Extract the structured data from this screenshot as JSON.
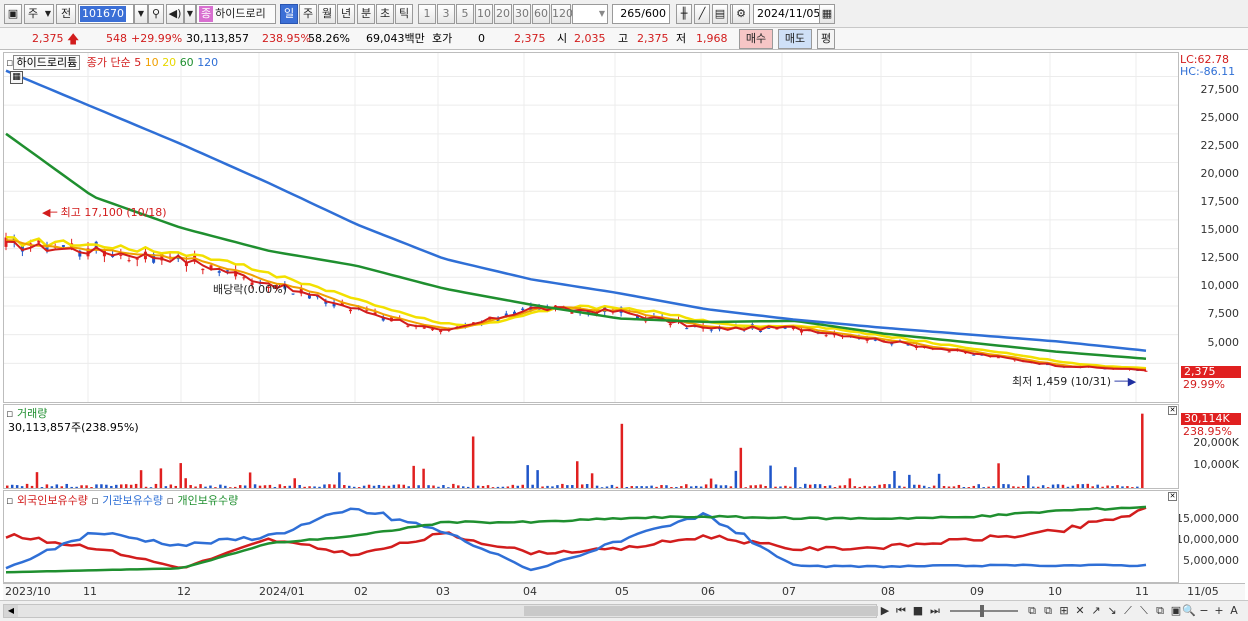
{
  "toolbar": {
    "period_select": "주",
    "prev_label": "전",
    "code": "101670",
    "stock_tag": "종",
    "stock_name": "하이드로리",
    "intervals": [
      "일",
      "주",
      "월",
      "년",
      "분",
      "초",
      "틱"
    ],
    "active_interval": "일",
    "counts": [
      "1",
      "3",
      "5",
      "10",
      "20",
      "30",
      "60",
      "120"
    ],
    "range_value": "265",
    "range_total": "/600",
    "date": "2024/11/05"
  },
  "quote": {
    "price": "2,375",
    "change": "548",
    "change_pct": "+29.99%",
    "volume": "30,113,857",
    "volume_pct": "238.95%",
    "turnover_pct": "58.26%",
    "amount": "69,043백만",
    "hoga_label": "호가",
    "hoga_value": "0",
    "hoga_price": "2,375",
    "open_label": "시",
    "open": "2,035",
    "high_label": "고",
    "high": "2,375",
    "low_label": "저",
    "low": "1,968",
    "buy_label": "매수",
    "sell_label": "매도",
    "avg_label": "평"
  },
  "price_panel": {
    "title": "하이드로리튬",
    "legend_main": "종가 단순",
    "ma_legend": [
      {
        "label": "5",
        "color": "#d21d1d"
      },
      {
        "label": "10",
        "color": "#f0a000"
      },
      {
        "label": "20",
        "color": "#f2e000"
      },
      {
        "label": "60",
        "color": "#1f8f2f"
      },
      {
        "label": "120",
        "color": "#2f6fd6"
      }
    ],
    "lc": "LC:62.78",
    "hc": "HC:-86.11",
    "high_note": "최고 17,100 (10/18)",
    "low_note": "최저 1,459 (10/31)",
    "dividend_note": "배당락(0.00%)",
    "last_price": "2,375",
    "last_pct": "29.99%",
    "y_ticks": [
      "27,500",
      "25,000",
      "22,500",
      "20,000",
      "17,500",
      "15,000",
      "12,500",
      "10,000",
      "7,500",
      "5,000"
    ]
  },
  "volume_panel": {
    "title": "거래량",
    "info": "30,113,857주(238.95%)",
    "last": "30,114K",
    "last_pct": "238.95%",
    "y_ticks": [
      "20,000K",
      "10,000K"
    ]
  },
  "holdings_panel": {
    "series": [
      {
        "label": "외국인보유수량",
        "color": "#d21d1d"
      },
      {
        "label": "기관보유수량",
        "color": "#2f6fd6"
      },
      {
        "label": "개인보유수량",
        "color": "#1f8f2f"
      }
    ],
    "y_ticks": [
      "15,000,000",
      "10,000,000",
      "5,000,000"
    ]
  },
  "x_axis": [
    "2023/10",
    "11",
    "12",
    "2024/01",
    "02",
    "03",
    "04",
    "05",
    "06",
    "07",
    "08",
    "09",
    "10",
    "11",
    "11/05"
  ],
  "chart_data": [
    {
      "type": "line",
      "title": "하이드로리튬",
      "ylim": [
        0,
        28500
      ],
      "series": [
        {
          "name": "120",
          "values": [
            28000,
            24800,
            21600,
            18200,
            14600,
            11600,
            9800,
            8600,
            7200,
            6300,
            5600,
            5000,
            4400,
            3600
          ]
        },
        {
          "name": "60",
          "values": [
            22500,
            17000,
            14300,
            12300,
            11000,
            9000,
            7600,
            6400,
            6100,
            6200,
            5100,
            4300,
            3500,
            2900
          ]
        },
        {
          "name": "5",
          "values": [
            12800,
            12300,
            11600,
            9500,
            7200,
            5200,
            7300,
            7000,
            5500,
            5600,
            4500,
            3400,
            2300,
            1900
          ]
        }
      ],
      "notes": [
        "최고 17,100 (10/18)",
        "최저 1,459 (10/31)"
      ]
    },
    {
      "type": "bar",
      "title": "거래량",
      "ylim": [
        0,
        32000
      ],
      "last_value": 30114
    },
    {
      "type": "line",
      "ylim": [
        0,
        20000000
      ],
      "series": [
        {
          "name": "외국인보유수량",
          "values": [
            11000000,
            8000000,
            2500000,
            10000000,
            6000000,
            11500000,
            6500000,
            7500000,
            11000000,
            7500000,
            8000000,
            10000000,
            12000000,
            17500000
          ]
        },
        {
          "name": "기관보유수량",
          "values": [
            2500000,
            12000000,
            8500000,
            11000000,
            18000000,
            12000000,
            2000000,
            9500000,
            16500000,
            3000000,
            3000000,
            3200000,
            3300000,
            3300000
          ]
        },
        {
          "name": "개인보유수량",
          "values": [
            1500000,
            2000000,
            2500000,
            9000000,
            11000000,
            14500000,
            14500000,
            15500000,
            16000000,
            15500000,
            15500000,
            15800000,
            17500000,
            18500000
          ]
        }
      ]
    }
  ]
}
